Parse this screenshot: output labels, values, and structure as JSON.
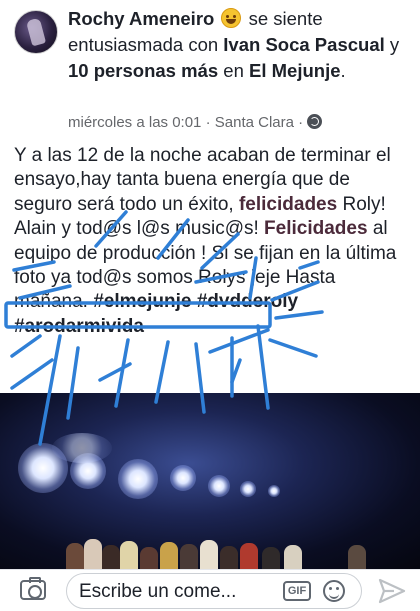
{
  "post": {
    "author": "Rochy Ameneiro",
    "feeling_text": "se siente entusiasmada con",
    "tagged_person": "Ivan Soca Pascual",
    "conjunction": "y",
    "others": "10 personas más",
    "location_prefix": "en",
    "location": "El Mejunje",
    "period": ".",
    "timestamp": "miércoles a las 0:01",
    "separator": "·",
    "place": "Santa Clara",
    "privacy_icon": "globe-icon",
    "body": {
      "line1": "Y a las 12 de la noche acaban de terminar el ensayo,hay tanta buena energía que de seguro será todo un éxito,",
      "felicidades1": "felicidades",
      "line2": " Roly! Alain y tod@s l@s music@s! ",
      "felicidades2": "Felicidades",
      "line3": " al equipo de producción ! Si se fijan en la última foto ya tod@s somos Rolys jeje Hasta mañana.",
      "tag1": "#elmejunje",
      "tag2": "#dvdderoly",
      "tag3": "#arodarmivida"
    }
  },
  "composer": {
    "placeholder": "Escribe un come...",
    "camera_icon": "camera-icon",
    "gif_label": "GIF",
    "sticker_icon": "sticker-icon",
    "send_icon": "send-icon"
  },
  "colors": {
    "link": "#4b2a3a",
    "scribble": "#2f7fd6",
    "meta": "#65676b"
  }
}
